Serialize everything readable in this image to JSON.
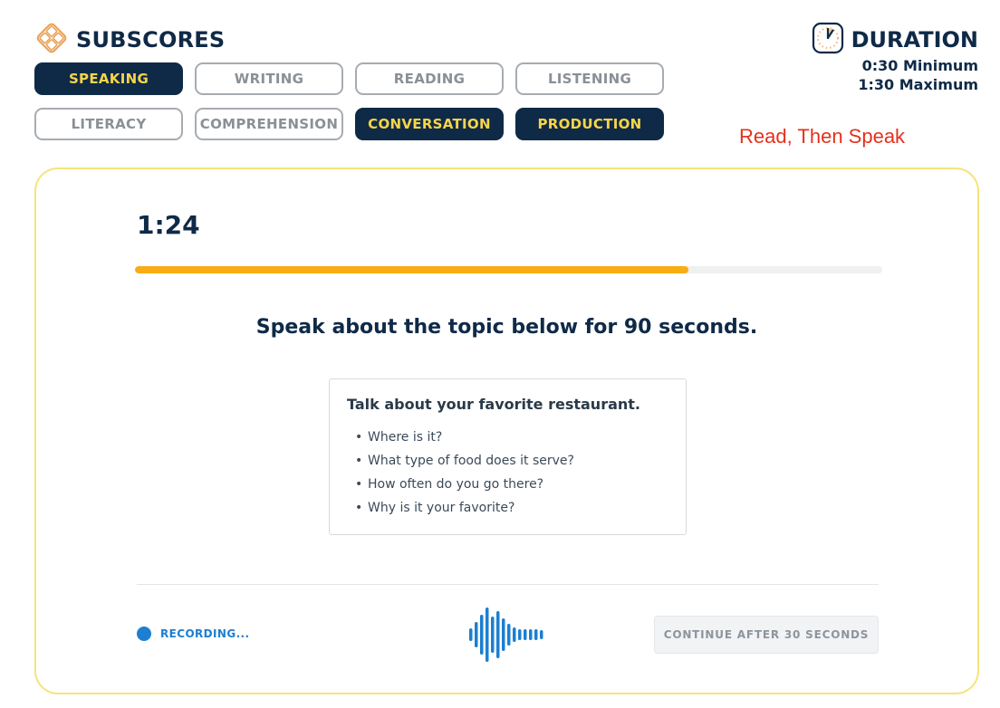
{
  "header": {
    "subscores_title": "SUBSCORES",
    "subscores_icon": "diamond-grid-icon",
    "chips": [
      {
        "label": "SPEAKING",
        "active": true
      },
      {
        "label": "WRITING",
        "active": false
      },
      {
        "label": "READING",
        "active": false
      },
      {
        "label": "LISTENING",
        "active": false
      },
      {
        "label": "LITERACY",
        "active": false
      },
      {
        "label": "COMPREHENSION",
        "active": false
      },
      {
        "label": "CONVERSATION",
        "active": true
      },
      {
        "label": "PRODUCTION",
        "active": true
      }
    ],
    "duration_title": "DURATION",
    "duration_icon": "clock-icon",
    "duration_min": "0:30 Minimum",
    "duration_max": "1:30 Maximum",
    "section_name": "Read, Then Speak"
  },
  "card": {
    "timer": "1:24",
    "progress": 0.74,
    "prompt": "Speak about the topic below for 90 seconds.",
    "topic": {
      "title": "Talk about your favorite restaurant.",
      "bullets": [
        "Where is it?",
        "What type of food does it serve?",
        "How often do you go there?",
        "Why is it your favorite?"
      ]
    },
    "recording_label": "RECORDING...",
    "continue_label": "CONTINUE AFTER 30 SECONDS"
  },
  "colors": {
    "navy": "#0f2a47",
    "accent_yellow": "#f7d54a",
    "progress_orange": "#f9ac13",
    "recording_blue": "#1c7fd1",
    "section_red": "#e3311d",
    "card_border": "#f5e47a"
  }
}
